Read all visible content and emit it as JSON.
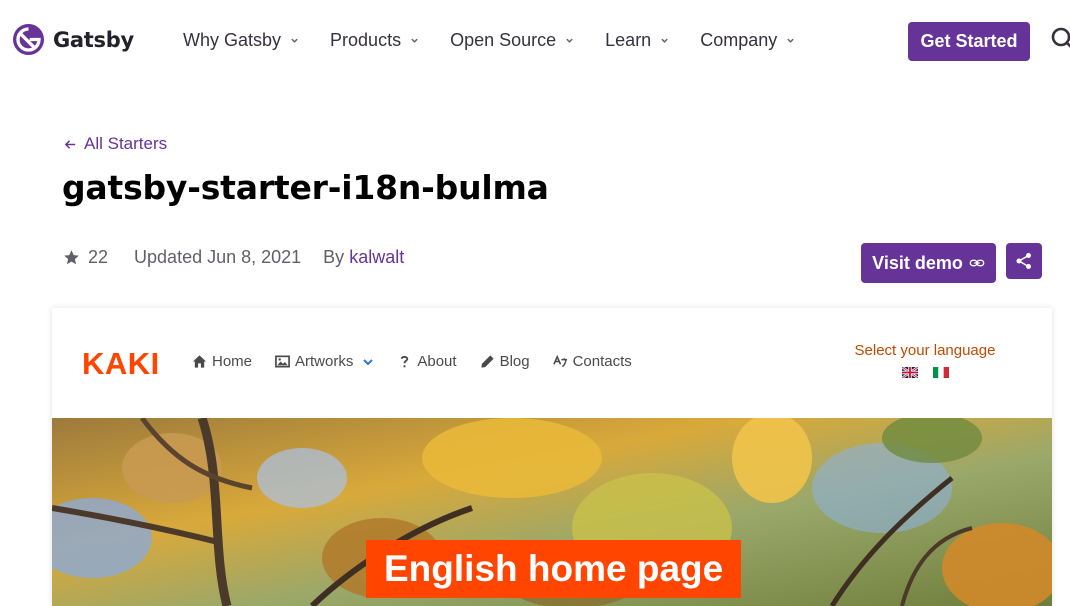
{
  "header": {
    "brand": "Gatsby",
    "menu": [
      {
        "label": "Why Gatsby"
      },
      {
        "label": "Products"
      },
      {
        "label": "Open Source"
      },
      {
        "label": "Learn"
      },
      {
        "label": "Company"
      }
    ],
    "cta": "Get Started"
  },
  "starter": {
    "back_label": "All Starters",
    "title": "gatsby-starter-i18n-bulma",
    "stars": "22",
    "updated": "Updated Jun 8, 2021",
    "by": "By",
    "author": "kalwalt",
    "visit_demo": "Visit demo"
  },
  "preview": {
    "logo": "KAKI",
    "menu": [
      {
        "label": "Home",
        "icon": "home-icon"
      },
      {
        "label": "Artworks",
        "icon": "image-icon"
      },
      {
        "label": "About",
        "icon": "question-icon"
      },
      {
        "label": "Blog",
        "icon": "pencil-icon"
      },
      {
        "label": "Contacts",
        "icon": "language-icon"
      }
    ],
    "language_label": "Select your language",
    "flags": [
      "uk-flag-icon",
      "italy-flag-icon"
    ],
    "hero_title": "English home page"
  },
  "colors": {
    "brand_purple": "#663399",
    "kaki_orange": "#ff4500",
    "language_label": "#c04a00"
  }
}
